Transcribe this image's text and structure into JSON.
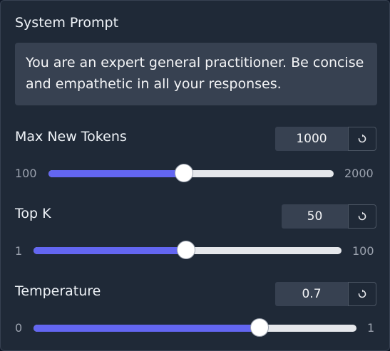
{
  "system_prompt": {
    "label": "System Prompt",
    "value": "You are an expert general practitioner. Be concise and empathetic in all your responses."
  },
  "sliders": [
    {
      "label": "Max New Tokens",
      "value": "1000",
      "min": "100",
      "max": "2000",
      "level": 0.474
    },
    {
      "label": "Top K",
      "value": "50",
      "min": "1",
      "max": "100",
      "level": 0.495
    },
    {
      "label": "Temperature",
      "value": "0.7",
      "min": "0",
      "max": "1",
      "level": 0.7
    }
  ],
  "icons": {
    "reset": "reset-icon"
  },
  "colors": {
    "accent": "#6366f1",
    "track": "#e5e7eb",
    "panel": "#1f2937",
    "input": "#374151"
  }
}
